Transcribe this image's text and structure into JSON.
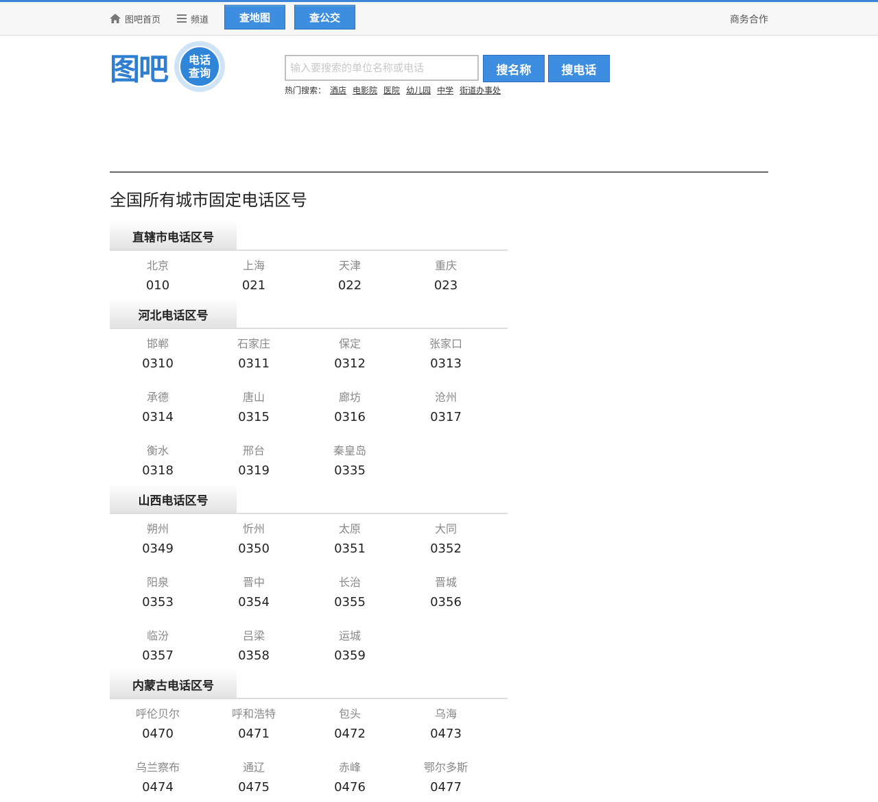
{
  "topbar": {
    "home": "图吧首页",
    "channel": "频道",
    "map_button": "查地图",
    "bus_button": "查公交",
    "business": "商务合作"
  },
  "logo": {
    "brand": "图吧",
    "badge_line1": "电话",
    "badge_line2": "查询"
  },
  "search": {
    "placeholder": "输入要搜索的单位名称或电话",
    "by_name": "搜名称",
    "by_phone": "搜电话",
    "hot_label": "热门搜索：",
    "hot_terms": [
      "酒店",
      "电影院",
      "医院",
      "幼儿园",
      "中学",
      "街道办事处"
    ]
  },
  "page": {
    "title": "全国所有城市固定电话区号"
  },
  "regions": [
    {
      "title": "直辖市电话区号",
      "cities": [
        {
          "name": "北京",
          "code": "010"
        },
        {
          "name": "上海",
          "code": "021"
        },
        {
          "name": "天津",
          "code": "022"
        },
        {
          "name": "重庆",
          "code": "023"
        }
      ]
    },
    {
      "title": "河北电话区号",
      "cities": [
        {
          "name": "邯郸",
          "code": "0310"
        },
        {
          "name": "石家庄",
          "code": "0311"
        },
        {
          "name": "保定",
          "code": "0312"
        },
        {
          "name": "张家口",
          "code": "0313"
        },
        {
          "name": "承德",
          "code": "0314"
        },
        {
          "name": "唐山",
          "code": "0315"
        },
        {
          "name": "廊坊",
          "code": "0316"
        },
        {
          "name": "沧州",
          "code": "0317"
        },
        {
          "name": "衡水",
          "code": "0318"
        },
        {
          "name": "邢台",
          "code": "0319"
        },
        {
          "name": "秦皇岛",
          "code": "0335"
        }
      ]
    },
    {
      "title": "山西电话区号",
      "cities": [
        {
          "name": "朔州",
          "code": "0349"
        },
        {
          "name": "忻州",
          "code": "0350"
        },
        {
          "name": "太原",
          "code": "0351"
        },
        {
          "name": "大同",
          "code": "0352"
        },
        {
          "name": "阳泉",
          "code": "0353"
        },
        {
          "name": "晋中",
          "code": "0354"
        },
        {
          "name": "长治",
          "code": "0355"
        },
        {
          "name": "晋城",
          "code": "0356"
        },
        {
          "name": "临汾",
          "code": "0357"
        },
        {
          "name": "吕梁",
          "code": "0358"
        },
        {
          "name": "运城",
          "code": "0359"
        }
      ]
    },
    {
      "title": "内蒙古电话区号",
      "cities": [
        {
          "name": "呼伦贝尔",
          "code": "0470"
        },
        {
          "name": "呼和浩特",
          "code": "0471"
        },
        {
          "name": "包头",
          "code": "0472"
        },
        {
          "name": "乌海",
          "code": "0473"
        },
        {
          "name": "乌兰察布",
          "code": "0474"
        },
        {
          "name": "通辽",
          "code": "0475"
        },
        {
          "name": "赤峰",
          "code": "0476"
        },
        {
          "name": "鄂尔多斯",
          "code": "0477"
        }
      ]
    }
  ]
}
